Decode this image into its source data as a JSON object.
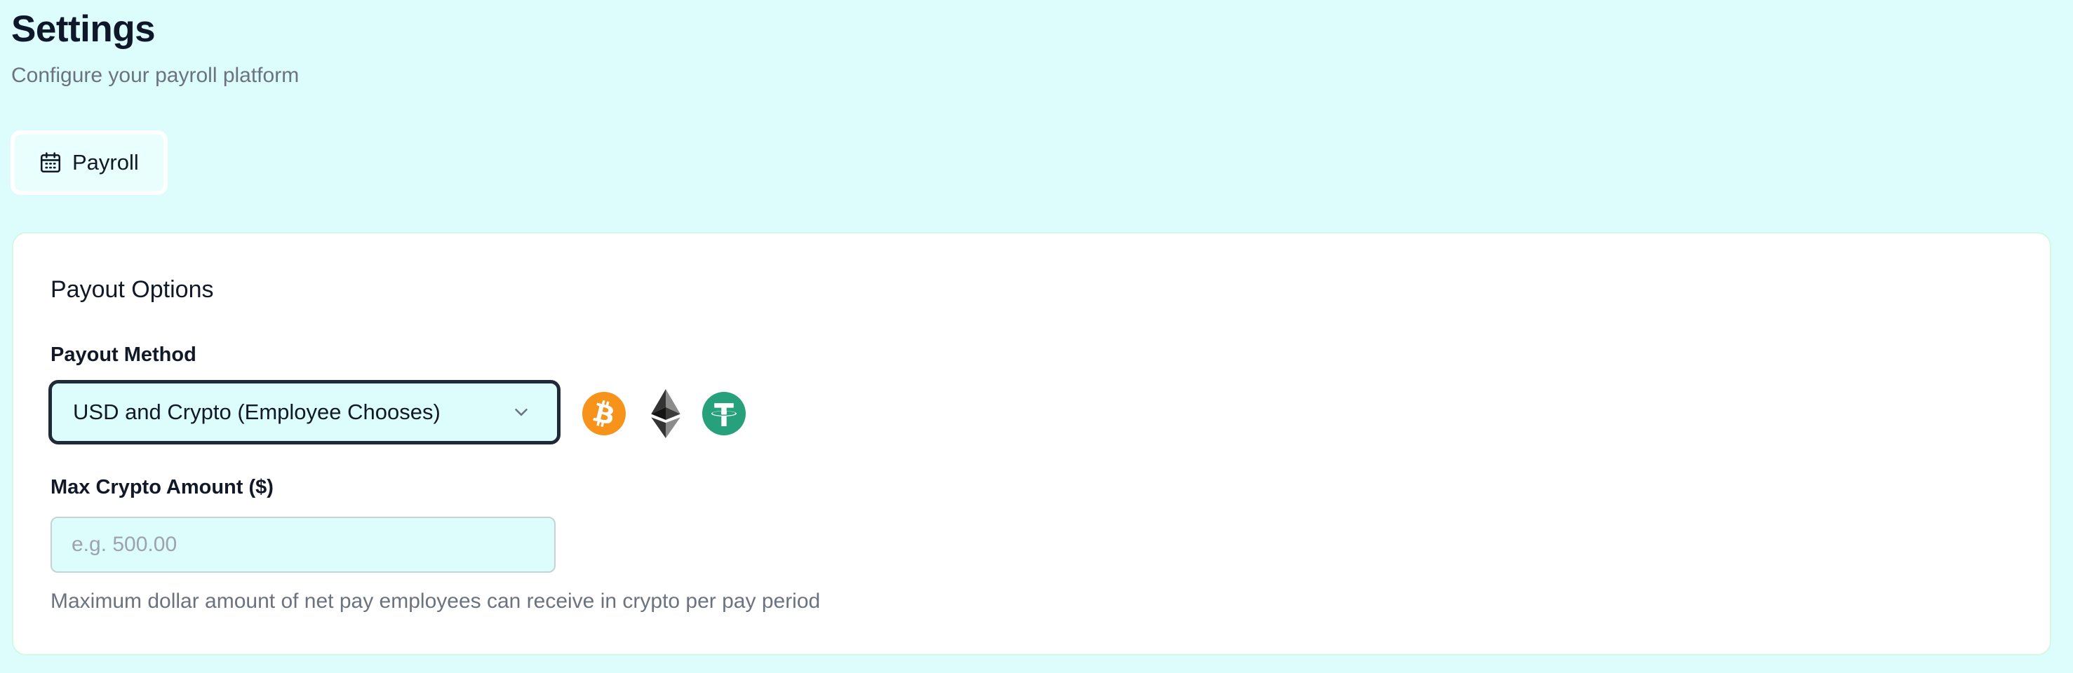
{
  "header": {
    "title": "Settings",
    "subtitle": "Configure your payroll platform"
  },
  "tabs": [
    {
      "label": "Payroll",
      "icon": "calendar-icon",
      "active": true
    }
  ],
  "payout_options": {
    "title": "Payout Options",
    "payout_method": {
      "label": "Payout Method",
      "selected": "USD and Crypto (Employee Chooses)"
    },
    "crypto_icons": [
      "bitcoin-icon",
      "ethereum-icon",
      "tether-icon"
    ],
    "max_crypto": {
      "label": "Max Crypto Amount ($)",
      "value": "",
      "placeholder": "e.g. 500.00",
      "help": "Maximum dollar amount of net pay employees can receive in crypto per pay period"
    }
  },
  "colors": {
    "background": "#dcfdfb",
    "card": "#ffffff",
    "bitcoin": "#f7931a",
    "ethereum": "#343434",
    "tether": "#26a17b"
  }
}
